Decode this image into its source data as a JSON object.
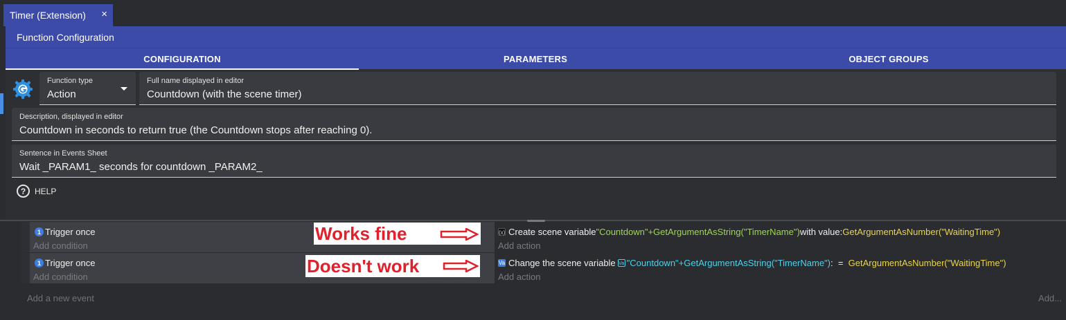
{
  "tab": {
    "title": "Timer (Extension)",
    "close_glyph": "×"
  },
  "dialog": {
    "title": "Function Configuration",
    "tabs": [
      "CONFIGURATION",
      "PARAMETERS",
      "OBJECT GROUPS"
    ],
    "function_type": {
      "label": "Function type",
      "value": "Action"
    },
    "full_name": {
      "label": "Full name displayed in editor",
      "value": "Countdown (with the scene timer)"
    },
    "description": {
      "label": "Description, displayed in editor",
      "value": "Countdown in seconds to return true (the Countdown stops after reaching 0)."
    },
    "sentence": {
      "label": "Sentence in Events Sheet",
      "value": "Wait _PARAM1_ seconds for countdown _PARAM2_"
    },
    "help": {
      "icon": "?",
      "label": "HELP"
    }
  },
  "events": [
    {
      "condition": "Trigger once",
      "badge": "1",
      "add_condition": "Add condition",
      "action": {
        "icon": "(x)",
        "prefix": "Create scene variable ",
        "name_expr": "\"Countdown\"+GetArgumentAsString(\"TimerName\")",
        "middle": " with value: ",
        "value_expr": "GetArgumentAsNumber(\"WaitingTime\")"
      },
      "add_action": "Add action",
      "annotation": "Works fine"
    },
    {
      "condition": "Trigger once",
      "badge": "1",
      "add_condition": "Add condition",
      "action": {
        "icon": "Va",
        "prefix": "Change the scene variable ",
        "var_icon": "Va",
        "name_expr": "\"Countdown\"+GetArgumentAsString(\"TimerName\")",
        "middle": ":  =  ",
        "value_expr": "GetArgumentAsNumber(\"WaitingTime\")"
      },
      "add_action": "Add action",
      "annotation": "Doesn't work"
    }
  ],
  "footer": {
    "add_event": "Add a new event",
    "add": "Add..."
  },
  "colors": {
    "accent": "#3c4ba8",
    "annotation_red": "#e0202a",
    "expr_green": "#9bd84a",
    "expr_yellow": "#e8d44d",
    "expr_cyan": "#4fd0e8"
  }
}
